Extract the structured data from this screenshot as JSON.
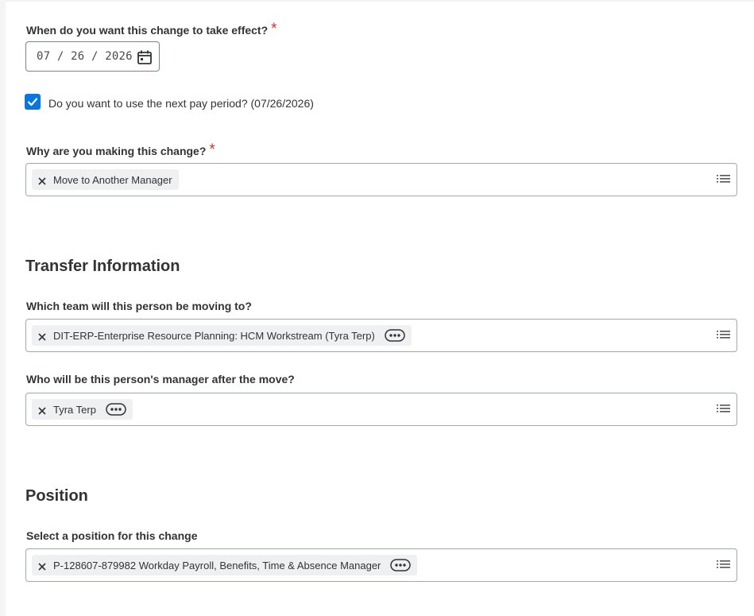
{
  "effective_date": {
    "question": "When do you want this change to take effect?",
    "required_mark": "*",
    "date_display": "07 / 26 / 2026",
    "icon": "calendar-icon"
  },
  "next_pay_period": {
    "checked": true,
    "label": "Do you want to use the next pay period? (07/26/2026)"
  },
  "reason": {
    "question": "Why are you making this change?",
    "required_mark": "*",
    "selected": "Move to Another Manager"
  },
  "transfer_section": {
    "title": "Transfer Information",
    "team_question": "Which team will this person be moving to?",
    "team_selected": "DIT-ERP-Enterprise Resource Planning: HCM Workstream (Tyra Terp)",
    "manager_question": "Who will be this person's manager after the move?",
    "manager_selected": "Tyra Terp"
  },
  "position_section": {
    "title": "Position",
    "question": "Select a position for this change",
    "selected": "P-128607-879982 Workday Payroll, Benefits, Time & Absence Manager"
  },
  "colors": {
    "accent": "#0875e1",
    "required": "#de2e21",
    "text": "#333333",
    "pill_bg": "#eef0f2"
  }
}
